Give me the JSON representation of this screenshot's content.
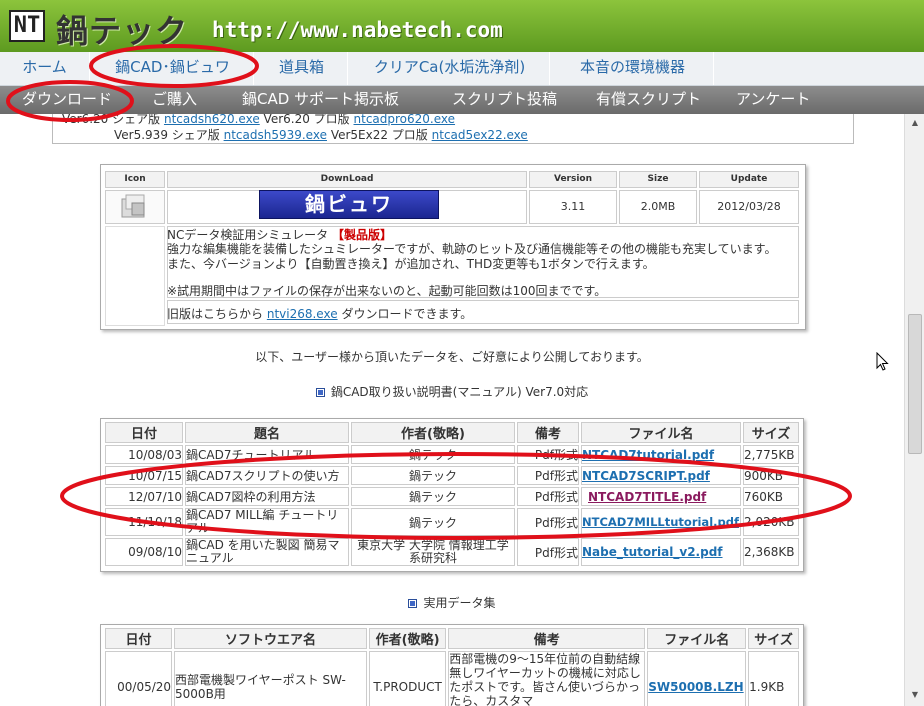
{
  "header": {
    "logo_text": "NT",
    "title": "鍋テック",
    "url": "http://www.nabetech.com"
  },
  "nav_main": [
    {
      "label": "ホーム"
    },
    {
      "label": "鍋CAD･鍋ビュワ"
    },
    {
      "label": "道具箱"
    },
    {
      "label": "クリアCa(水垢洗浄剤)"
    },
    {
      "label": "本音の環境機器"
    }
  ],
  "nav_sub": [
    {
      "label": "ダウンロード"
    },
    {
      "label": "ご購入"
    },
    {
      "label": "鍋CAD サポート掲示板"
    },
    {
      "label": "スクリプト投稿"
    },
    {
      "label": "有償スクリプト"
    },
    {
      "label": "アンケート"
    }
  ],
  "prev_section": {
    "line1_prefix": "Ver6.20 シェア版",
    "line1_link1": "ntcadsh620.exe",
    "line1_mid": "Ver6.20 プロ版",
    "line1_link2": "ntcadpro620.exe",
    "line2_prefix": "Ver5.939 シェア版",
    "line2_link1": "ntcadsh5939.exe",
    "line2_mid": "Ver5Ex22 プロ版",
    "line2_link2": "ntcad5ex22.exe"
  },
  "download": {
    "headers": {
      "icon": "Icon",
      "download": "DownLoad",
      "version": "Version",
      "size": "Size",
      "update": "Update"
    },
    "banner": "鍋ビュワ",
    "version": "3.11",
    "size": "2.0MB",
    "update": "2012/03/28",
    "desc_line1_prefix": "NCデータ検証用シミュレータ",
    "desc_line1_tag": "【製品版】",
    "desc_line2": "強力な編集機能を装備したシュミレーターですが、軌跡のヒット及び通信機能等その他の機能も充実しています。",
    "desc_line3": "また、今バージョンより【自動置き換え】が追加され、THD変更等も1ボタンで行えます。",
    "desc_line4": "※試用期間中はファイルの保存が出来ないのと、起動可能回数は100回までです。",
    "old_prefix": "旧版はこちらから",
    "old_link": "ntvi268.exe",
    "old_suffix": "ダウンロードできます。"
  },
  "notice": "以下、ユーザー様から頂いたデータを、ご好意により公開しております。",
  "manual_section": {
    "title": "鍋CAD取り扱い説明書(マニュアル) Ver7.0対応",
    "headers": [
      "日付",
      "題名",
      "作者(敬略)",
      "備考",
      "ファイル名",
      "サイズ"
    ],
    "rows": [
      {
        "date": "10/08/03",
        "title": "鍋CAD7チュートリアル",
        "author": "鍋テック",
        "note": "Pdf形式",
        "file": "NTCAD7tutorial.pdf",
        "size": "2,775KB"
      },
      {
        "date": "10/07/15",
        "title": "鍋CAD7スクリプトの使い方",
        "author": "鍋テック",
        "note": "Pdf形式",
        "file": "NTCAD7SCRIPT.pdf",
        "size": "900KB"
      },
      {
        "date": "12/07/10",
        "title": "鍋CAD7図枠の利用方法",
        "author": "鍋テック",
        "note": "Pdf形式",
        "file": "NTCAD7TITLE.pdf",
        "size": "760KB"
      },
      {
        "date": "11/10/18",
        "title": "鍋CAD7 MILL編 チュートリアル",
        "author": "鍋テック",
        "note": "Pdf形式",
        "file": "NTCAD7MILLtutorial.pdf",
        "size": "2,020KB"
      },
      {
        "date": "09/08/10",
        "title": "鍋CAD を用いた製図 簡易マニュアル",
        "author": "東京大学 大学院 情報理工学系研究科",
        "note": "Pdf形式",
        "file": "Nabe_tutorial_v2.pdf",
        "size": "2,368KB"
      }
    ]
  },
  "data_section": {
    "title": "実用データ集",
    "headers": [
      "日付",
      "ソフトウエア名",
      "作者(敬略)",
      "備考",
      "ファイル名",
      "サイズ"
    ],
    "rows": [
      {
        "date": "00/05/20",
        "software": "西部電機製ワイヤーポスト SW-5000B用",
        "author": "T.PRODUCT",
        "note": "西部電機の9～15年位前の自動結線無しワイヤーカットの機械に対応したポストです。皆さん使いづらかったら、カスタマ",
        "file": "SW5000B.LZH",
        "size": "1.9KB"
      }
    ]
  },
  "colors": {
    "header_green": "#6aa82a",
    "link_blue": "#1d6fb0",
    "annotation_red": "#e0101a",
    "nav_gray": "#7a7a7a"
  }
}
